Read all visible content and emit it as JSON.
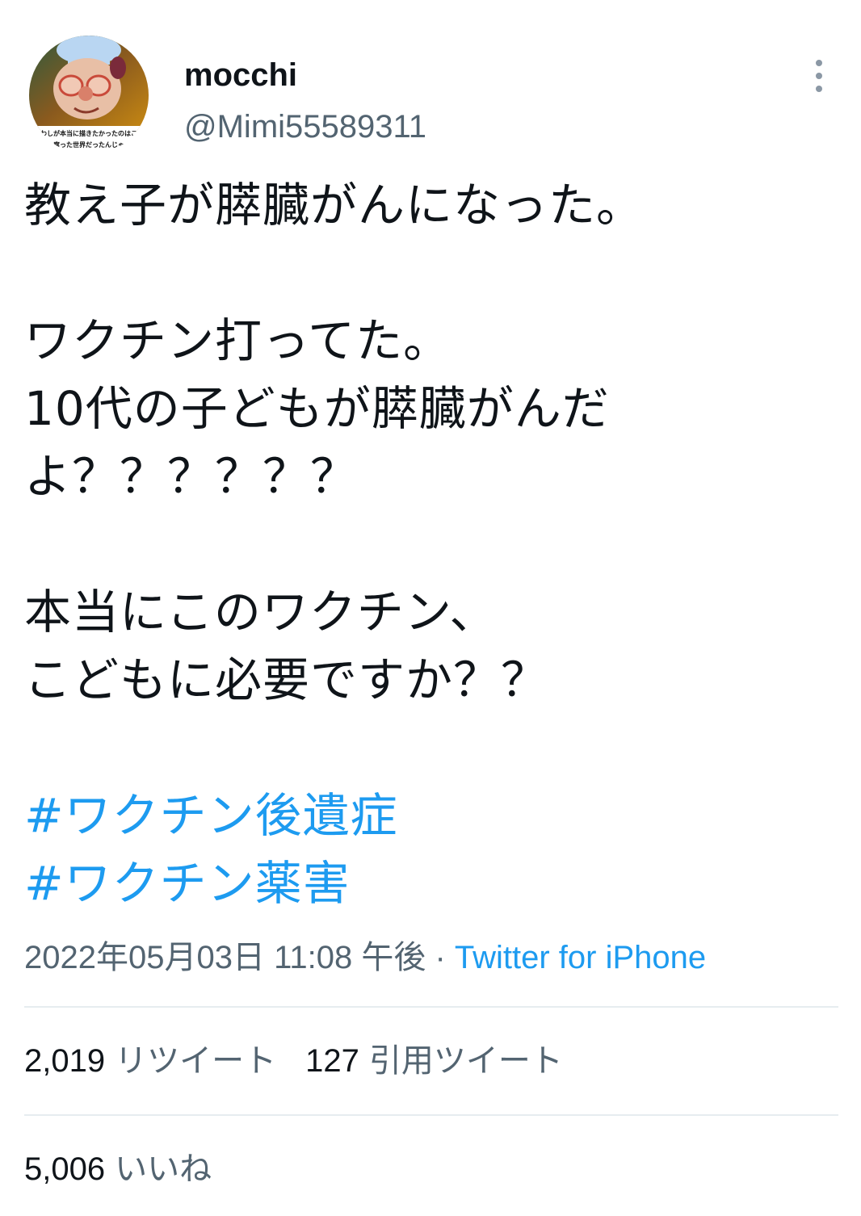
{
  "user": {
    "display_name": "mocchi",
    "handle": "@Mimi55589311",
    "avatar_caption": "わしが本当に描きたかったのはこの腐った世界だったんじゃよ"
  },
  "tweet": {
    "lines": [
      "教え子が膵臓がんになった。",
      "",
      "ワクチン打ってた。",
      "10代の子どもが膵臓がんだ",
      "よ？？？？？？",
      "",
      "本当にこのワクチン、",
      "こどもに必要ですか？？",
      ""
    ],
    "hashtags": [
      "#ワクチン後遺症",
      "#ワクチン薬害"
    ]
  },
  "meta": {
    "timestamp": "2022年05月03日 11:08 午後",
    "separator": " · ",
    "source": "Twitter for iPhone"
  },
  "stats": {
    "retweets": {
      "count": "2,019",
      "label": "リツイート"
    },
    "quotes": {
      "count": "127",
      "label": "引用ツイート"
    },
    "likes": {
      "count": "5,006",
      "label": "いいね"
    }
  },
  "icons": {
    "more": "more-vertical-icon"
  },
  "colors": {
    "link": "#1d9bf0",
    "secondary_text": "#536471",
    "primary_text": "#0f1419",
    "divider": "#e6ecf0"
  }
}
